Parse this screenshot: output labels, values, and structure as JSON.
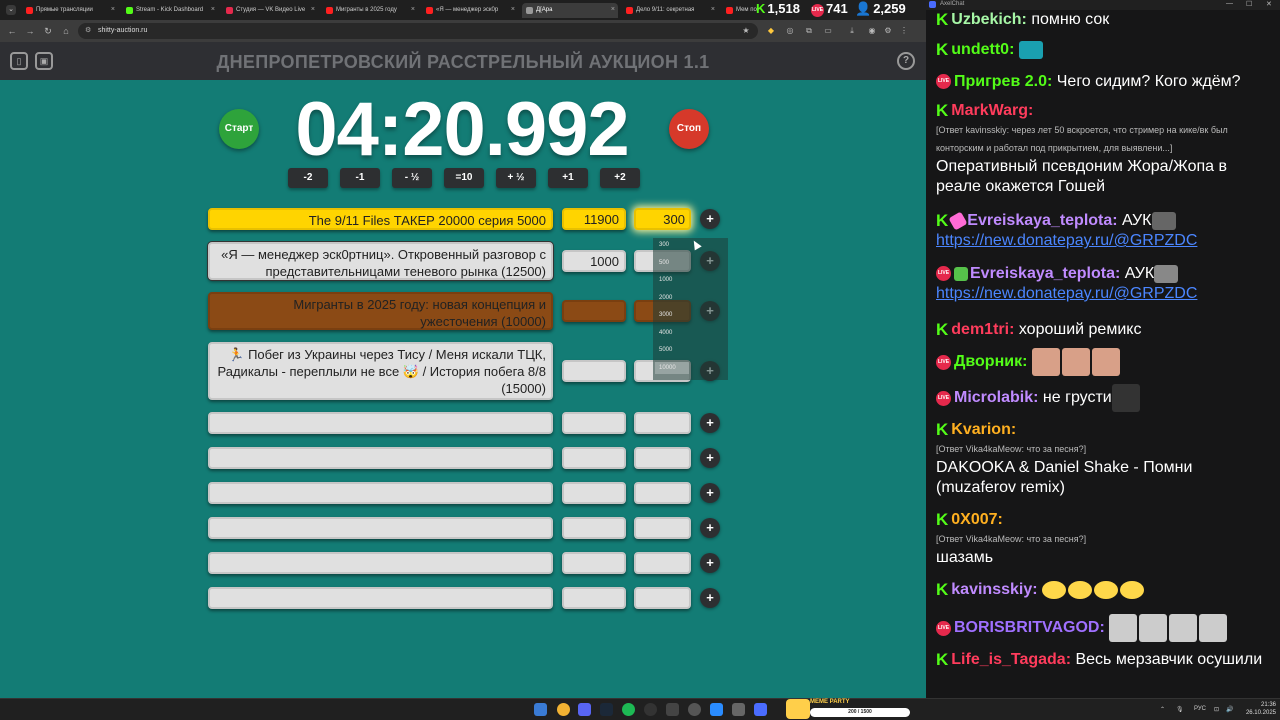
{
  "browser": {
    "tabs": [
      {
        "title": "Прямые трансляции",
        "color": "#ff2020"
      },
      {
        "title": "Stream - Kick Dashboard",
        "color": "#53fc18"
      },
      {
        "title": "Студия — VK Видео Live",
        "color": "#e5294c"
      },
      {
        "title": "Мигранты в 2025 году",
        "color": "#ff2020"
      },
      {
        "title": "«Я — менеджер эск0р",
        "color": "#ff2020"
      },
      {
        "title": "Д[Ара",
        "color": "#999999"
      },
      {
        "title": "Дело 9/11: секретная",
        "color": "#ff2020"
      },
      {
        "title": "Мем по",
        "color": "#ff2020"
      }
    ],
    "url": "shitty-auction.ru"
  },
  "overlay": {
    "kick_viewers": "1,518",
    "vk_viewers": "741",
    "total_viewers": "2,259",
    "kick_color": "#53fc18",
    "vk_color": "#e5294c",
    "total_color": "#2f9bff"
  },
  "auction": {
    "title": "ДНЕПРОПЕТРОВСКИЙ РАССТРЕЛЬНЫЙ АУКЦИОН 1.1",
    "start_label": "Старт",
    "stop_label": "Стоп",
    "timer": "04:20.992",
    "adjust_buttons": [
      "-2",
      "-1",
      "- ½",
      "=10",
      "+ ½",
      "+1",
      "+2"
    ],
    "lots": [
      {
        "name": "The 9/11 Files ТАКЕР 20000 серия 5000",
        "amount": "11900",
        "add": "300",
        "style": "gold"
      },
      {
        "name": "«Я — менеджер эск0ртниц». Откровенный разговор с представительницами теневого рынка (12500)",
        "amount": "1000",
        "add": "",
        "style": "selected"
      },
      {
        "name": "Мигранты в 2025 году: новая концепция и ужесточения (10000)",
        "amount": "",
        "add": "",
        "style": "brown"
      },
      {
        "name": "🏃 Побег из Украины через Тису / Меня искали ТЦК, Радикалы - переплыли не все 🤯 / История побега 8/8 (15000)",
        "amount": "",
        "add": "",
        "style": ""
      },
      {
        "name": "",
        "amount": "",
        "add": "",
        "style": ""
      },
      {
        "name": "",
        "amount": "",
        "add": "",
        "style": ""
      },
      {
        "name": "",
        "amount": "",
        "add": "",
        "style": ""
      },
      {
        "name": "",
        "amount": "",
        "add": "",
        "style": ""
      },
      {
        "name": "",
        "amount": "",
        "add": "",
        "style": ""
      },
      {
        "name": "",
        "amount": "",
        "add": "",
        "style": ""
      }
    ],
    "add_dropdown_options": [
      "300",
      "500",
      "1000",
      "2000",
      "3000",
      "4000",
      "5000",
      "10000"
    ],
    "add_dropdown_selected": "10000",
    "colors": {
      "background": "#137c75",
      "gold": "#ffd400",
      "brown": "#8b4a15",
      "start": "#2ea33b",
      "stop": "#d6392a"
    }
  },
  "chat": {
    "app_title": "AxelChat",
    "messages": [
      {
        "platform": "kick",
        "nick": "Uzbekich",
        "nick_color": "#a6f6a6",
        "text": "помню сок"
      },
      {
        "platform": "kick",
        "nick": "undett0",
        "nick_color": "#53fc18",
        "text": ""
      },
      {
        "platform": "vk",
        "nick": "Пригрев 2.0",
        "nick_color": "#53fc18",
        "text": "Чего сидим? Кого ждём?"
      },
      {
        "platform": "kick",
        "nick": "MarkWarg",
        "nick_color": "#ff3c5c",
        "reply": "[Ответ kavinsskiy: через лет 50 вскроется, что стример на кике/вк был конторским и работал под прикрытием, для выявлени...]",
        "text": "Оперативный псевдоним Жора/Жопа в реале окажется Гошей"
      },
      {
        "platform": "kick",
        "nick": "Evreiskaya_teplota",
        "nick_color": "#c08bff",
        "text": "АУК",
        "link": "https://new.donatepay.ru/@GRPZDC"
      },
      {
        "platform": "vk",
        "nick": "Evreiskaya_teplota",
        "nick_color": "#c08bff",
        "text": "АУК",
        "link": "https://new.donatepay.ru/@GRPZDC"
      },
      {
        "platform": "kick",
        "nick": "dem1tri",
        "nick_color": "#ff3c5c",
        "text": "хороший ремикс"
      },
      {
        "platform": "vk",
        "nick": "Дворник",
        "nick_color": "#53fc18",
        "text": ""
      },
      {
        "platform": "vk",
        "nick": "Microlabik",
        "nick_color": "#c08bff",
        "text": "не грусти"
      },
      {
        "platform": "kick",
        "nick": "Kvarion",
        "nick_color": "#ffb020",
        "reply": "[Ответ Vika4kaMeow: что за песня?]",
        "text": "DAKOOKA & Daniel Shake - Помни (muzaferov remix)"
      },
      {
        "platform": "kick",
        "nick": "0X007",
        "nick_color": "#ffb020",
        "reply": "[Ответ Vika4kaMeow: что за песня?]",
        "text": "шазамь"
      },
      {
        "platform": "kick",
        "nick": "kavinsskiy",
        "nick_color": "#c08bff",
        "text": ""
      },
      {
        "platform": "vk",
        "nick": "BORISBRITVAGOD",
        "nick_color": "#a070ff",
        "text": ""
      },
      {
        "platform": "kick",
        "nick": "Life_is_Tagada",
        "nick_color": "#ff3c5c",
        "text": "Весь мерзавчик осушили"
      }
    ]
  },
  "taskbar": {
    "meme_party_label": "MEME PARTY",
    "meme_party_counter": "200 / 1500",
    "lang": "РУС",
    "time": "21:36",
    "date": "26.10.2025"
  }
}
